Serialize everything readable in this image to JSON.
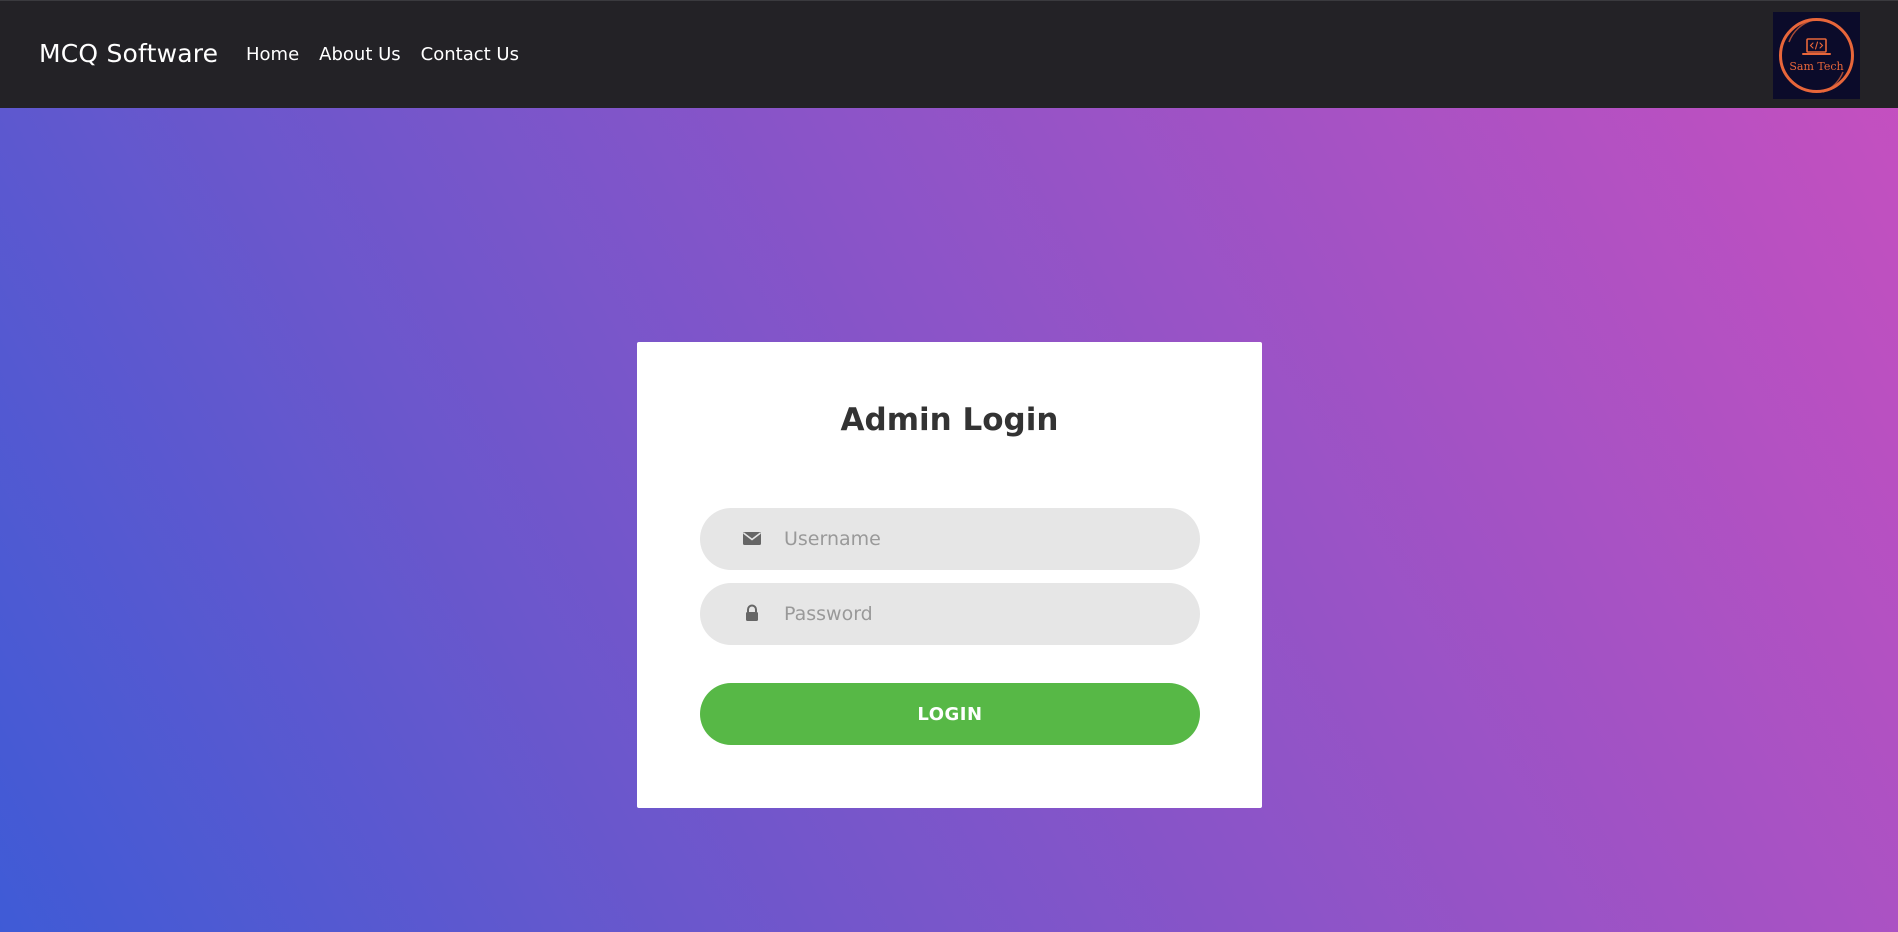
{
  "navbar": {
    "brand": "MCQ Software",
    "links": [
      "Home",
      "About Us",
      "Contact Us"
    ],
    "logo": {
      "icon": "laptop-code-icon",
      "text": "Sam Tech",
      "ring_color": "#e8663a",
      "background": "#0b0b2a"
    }
  },
  "login": {
    "title": "Admin Login",
    "username": {
      "icon": "envelope-icon",
      "placeholder": "Username",
      "value": ""
    },
    "password": {
      "icon": "lock-icon",
      "placeholder": "Password",
      "value": ""
    },
    "button_label": "LOGIN"
  },
  "colors": {
    "navbar_bg": "#232226",
    "gradient_start": "#3f5bd6",
    "gradient_end": "#c74fbf",
    "button_green": "#57b846",
    "input_bg": "#e6e6e6"
  }
}
